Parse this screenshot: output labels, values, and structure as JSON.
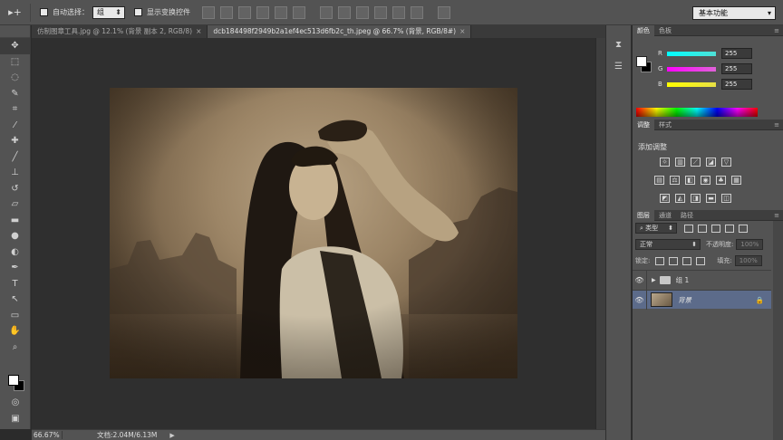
{
  "options_bar": {
    "tool_glyph": "▸+",
    "auto_select_label": "自动选择：",
    "auto_select_value": "组",
    "show_transform_label": "显示变换控件",
    "workspace": "基本功能"
  },
  "tabs": [
    {
      "title": "仿制图章工具.jpg @ 12.1% (背景 副本 2, RGB/8)",
      "close": "×",
      "active": false
    },
    {
      "title": "dcb184498f2949b2a1ef4ec513d6fb2c_th.jpeg @ 66.7% (背景, RGB/8#)",
      "close": "×",
      "active": true
    }
  ],
  "status_bar": {
    "zoom": "66.67%",
    "doc_info": "文档:2.04M/6.13M",
    "play": "▶"
  },
  "color_panel": {
    "tab_color": "颜色",
    "tab_swatches": "色板",
    "channels": [
      {
        "label": "R",
        "value": "255",
        "color": "#3fd9d0"
      },
      {
        "label": "G",
        "value": "255",
        "color": "#e354d6"
      },
      {
        "label": "B",
        "value": "255",
        "color": "#e6df3a"
      }
    ]
  },
  "adjustments_panel": {
    "tab_adjust": "调整",
    "tab_styles": "样式",
    "title": "添加调整"
  },
  "layers_panel": {
    "tab_layers": "图层",
    "tab_channels": "通道",
    "tab_paths": "路径",
    "filter_kind": "类型",
    "blend_mode": "正常",
    "opacity_label": "不透明度:",
    "opacity_value": "100%",
    "lock_label": "锁定:",
    "fill_label": "填充:",
    "fill_value": "100%",
    "layers": [
      {
        "name": "组 1",
        "type": "group",
        "selected": false
      },
      {
        "name": "背景",
        "type": "image",
        "selected": true
      }
    ]
  }
}
